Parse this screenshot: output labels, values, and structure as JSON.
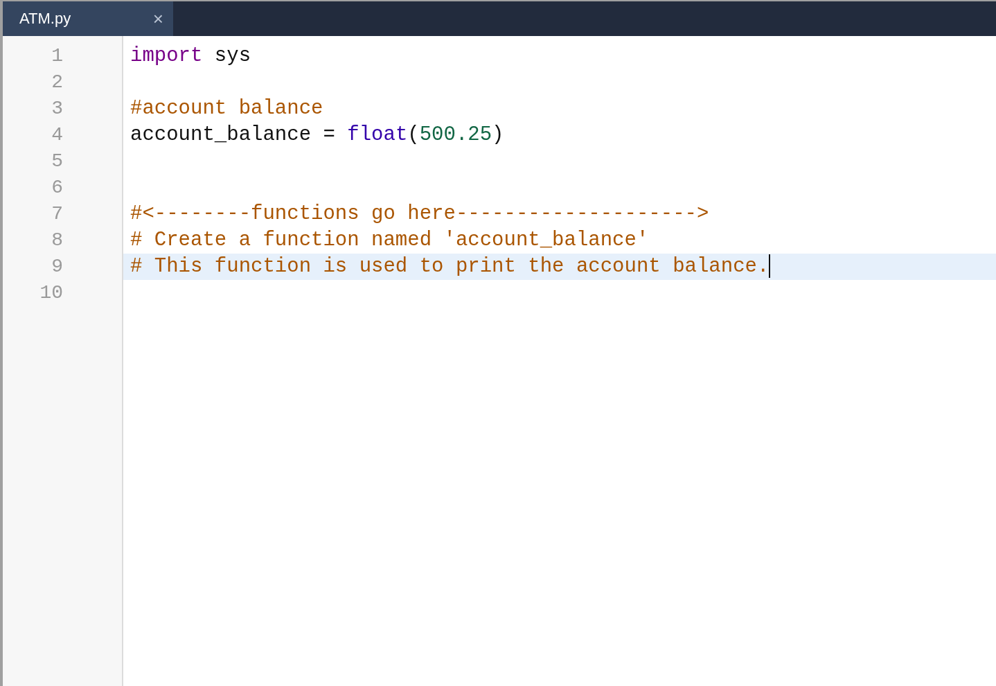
{
  "tab": {
    "title": "ATM.py",
    "close": "×",
    "selected": true
  },
  "lines": [
    {
      "number": "1",
      "active": false,
      "tokens": [
        {
          "kind": "keyword",
          "text": "import"
        },
        {
          "kind": "plain",
          "text": " sys"
        }
      ]
    },
    {
      "number": "2",
      "active": false
    },
    {
      "number": "3",
      "active": false,
      "tokens": [
        {
          "kind": "comment",
          "text": "#account balance"
        }
      ]
    },
    {
      "number": "4",
      "active": false,
      "tokens": [
        {
          "kind": "plain",
          "text": "account_balance = "
        },
        {
          "kind": "builtin",
          "text": "float"
        },
        {
          "kind": "plain",
          "text": "("
        },
        {
          "kind": "number",
          "text": "500.25"
        },
        {
          "kind": "plain",
          "text": ")"
        }
      ]
    },
    {
      "number": "5",
      "active": false
    },
    {
      "number": "6",
      "active": false
    },
    {
      "number": "7",
      "active": false,
      "tokens": [
        {
          "kind": "comment",
          "text": "#<--------functions go here-------------------->"
        }
      ]
    },
    {
      "number": "8",
      "active": false,
      "tokens": [
        {
          "kind": "comment",
          "text": "# Create a function named 'account_balance'"
        }
      ]
    },
    {
      "number": "9",
      "active": true,
      "tokens": [
        {
          "kind": "comment",
          "text": "# This function is used to print the account balance."
        }
      ]
    },
    {
      "number": "10",
      "active": false
    }
  ]
}
